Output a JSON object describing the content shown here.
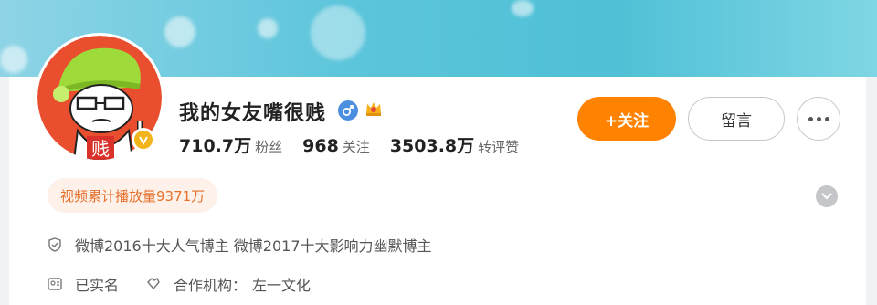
{
  "profile": {
    "name": "我的女友嘴很贱",
    "avatar_badge_letter": "贱",
    "stats": [
      {
        "value": "710.7万",
        "label": "粉丝"
      },
      {
        "value": "968",
        "label": "关注"
      },
      {
        "value": "3503.8万",
        "label": "转评赞"
      }
    ]
  },
  "actions": {
    "follow_label": "+关注",
    "message_label": "留言"
  },
  "views_badge": "视频累计播放量9371万",
  "info": {
    "honors": "微博2016十大人气博主 微博2017十大影响力幽默博主",
    "verified": "已实名",
    "agency_label": "合作机构：",
    "agency_name": "左一文化"
  },
  "colors": {
    "follow_button": "#ff8200",
    "views_badge_text": "#e6702a",
    "verified_badge": "#f3b41b",
    "gender_badge": "#4a8fe0"
  }
}
